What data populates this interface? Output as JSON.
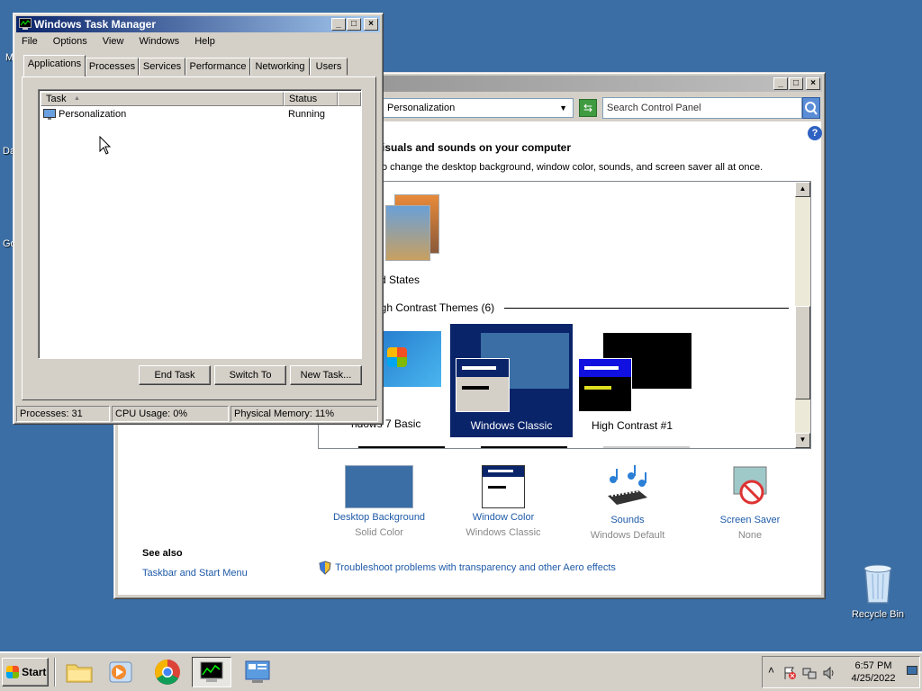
{
  "desktop": {
    "fragments": [
      "M",
      "Da",
      "Go"
    ],
    "recycle_bin": "Recycle Bin"
  },
  "control_panel": {
    "breadcrumb": "Personalization",
    "search_placeholder": "Search Control Panel",
    "heading": "isuals and sounds on your computer",
    "description": "o change the desktop background, window color, sounds, and screen saver all at once.",
    "group_partial_label": "d States",
    "section_label": "igh Contrast Themes (6)",
    "themes": [
      {
        "name": "Windows 7 Basic",
        "shown": "ndows 7 Basic",
        "selected": false
      },
      {
        "name": "Windows Classic",
        "shown": "Windows Classic",
        "selected": true
      },
      {
        "name": "High Contrast #1",
        "shown": "High Contrast #1",
        "selected": false
      }
    ],
    "properties": [
      {
        "label": "Desktop Background",
        "value": "Solid Color",
        "icon": "desktop-background-icon"
      },
      {
        "label": "Window Color",
        "value": "Windows Classic",
        "icon": "window-color-icon"
      },
      {
        "label": "Sounds",
        "value": "Windows Default",
        "icon": "sounds-icon"
      },
      {
        "label": "Screen Saver",
        "value": "None",
        "icon": "screen-saver-icon"
      }
    ],
    "see_also_title": "See also",
    "see_also_link": "Taskbar and Start Menu",
    "troubleshoot_link": "Troubleshoot problems with transparency and other Aero effects"
  },
  "task_manager": {
    "title": "Windows Task Manager",
    "menu": [
      "File",
      "Options",
      "View",
      "Windows",
      "Help"
    ],
    "tabs": [
      "Applications",
      "Processes",
      "Services",
      "Performance",
      "Networking",
      "Users"
    ],
    "selected_tab": "Applications",
    "columns": [
      "Task",
      "Status"
    ],
    "rows": [
      {
        "task": "Personalization",
        "status": "Running"
      }
    ],
    "buttons": [
      "End Task",
      "Switch To",
      "New Task..."
    ],
    "status": {
      "processes": "Processes: 31",
      "cpu": "CPU Usage: 0%",
      "memory": "Physical Memory: 11%"
    }
  },
  "taskbar": {
    "start": "Start",
    "time": "6:57 PM",
    "date": "4/25/2022"
  },
  "colors": {
    "desktop": "#3a6ea5",
    "titlebar_active": "#0a246a",
    "selection": "#0a246a",
    "link": "#1e5aa8"
  }
}
